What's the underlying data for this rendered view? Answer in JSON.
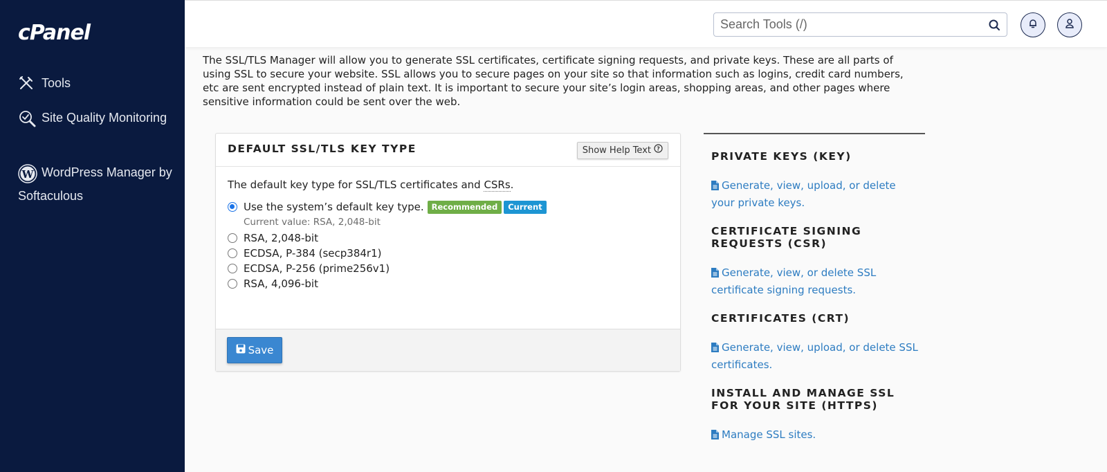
{
  "sidebar": {
    "logo": "cPanel",
    "items": [
      {
        "label": "Tools",
        "icon": "tools-icon"
      },
      {
        "label": "Site Quality Monitoring",
        "icon": "site-quality-icon"
      },
      {
        "label": "WordPress Manager by Softaculous",
        "icon": "wordpress-icon"
      }
    ]
  },
  "header": {
    "search_placeholder": "Search Tools (/)",
    "search_value": "",
    "bell_icon": "bell-icon",
    "user_icon": "user-icon"
  },
  "intro": "The SSL/TLS Manager will allow you to generate SSL certificates, certificate signing requests, and private keys. These are all parts of using SSL to secure your website. SSL allows you to secure pages on your site so that information such as logins, credit card numbers, etc are sent encrypted instead of plain text. It is important to secure your site’s login areas, shopping areas, and other pages where sensitive information could be sent over the web.",
  "panel": {
    "title": "DEFAULT SSL/TLS KEY TYPE",
    "help_button": "Show Help Text",
    "description_prefix": "The default key type for SSL/TLS certificates and ",
    "description_abbr": "CSRs",
    "description_suffix": ".",
    "options": [
      {
        "label": "Use the system’s default key type.",
        "checked": true
      },
      {
        "label": "RSA, 2,048-bit",
        "checked": false
      },
      {
        "label": "ECDSA, P-384 (secp384r1)",
        "checked": false
      },
      {
        "label": "ECDSA, P-256 (prime256v1)",
        "checked": false
      },
      {
        "label": "RSA, 4,096-bit",
        "checked": false
      }
    ],
    "badges": {
      "recommended": "Recommended",
      "current": "Current"
    },
    "current_value": "Current value: RSA, 2,048-bit",
    "save_label": "Save"
  },
  "right": {
    "sections": [
      {
        "title": "PRIVATE KEYS (KEY)",
        "link": "Generate, view, upload, or delete your private keys."
      },
      {
        "title": "CERTIFICATE SIGNING REQUESTS (CSR)",
        "link": "Generate, view, or delete SSL certificate signing requests."
      },
      {
        "title": "CERTIFICATES (CRT)",
        "link": "Generate, view, upload, or delete SSL certificates."
      },
      {
        "title": "INSTALL AND MANAGE SSL FOR YOUR SITE (HTTPS)",
        "link": "Manage SSL sites."
      }
    ]
  },
  "colors": {
    "sidebar_bg": "#0a1a3f",
    "link": "#2d7cc1",
    "primary_button": "#3a87d1",
    "badge_recommended": "#6fae47",
    "badge_current": "#1d95d3"
  }
}
